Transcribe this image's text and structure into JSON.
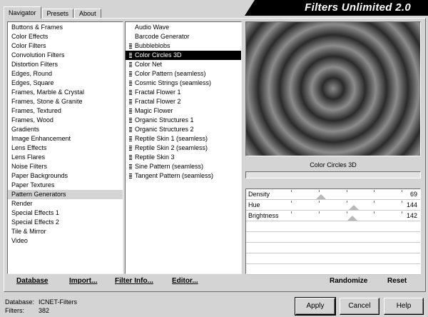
{
  "tabs": [
    "Navigator",
    "Presets",
    "About"
  ],
  "app_title": "Filters Unlimited 2.0",
  "categories": [
    "Buttons & Frames",
    "Color Effects",
    "Color Filters",
    "Convolution Filters",
    "Distortion Filters",
    "Edges, Round",
    "Edges, Square",
    "Frames, Marble & Crystal",
    "Frames, Stone & Granite",
    "Frames, Textured",
    "Frames, Wood",
    "Gradients",
    "Image Enhancement",
    "Lens Effects",
    "Lens Flares",
    "Noise Filters",
    "Paper Backgrounds",
    "Paper Textures",
    "Pattern Generators",
    "Render",
    "Special Effects 1",
    "Special Effects 2",
    "Tile & Mirror",
    "Video"
  ],
  "selected_category": 18,
  "filters": [
    {
      "label": "Audio Wave",
      "marked": false
    },
    {
      "label": "Barcode Generator",
      "marked": false
    },
    {
      "label": "Bubbleblobs",
      "marked": true
    },
    {
      "label": "Color Circles 3D",
      "marked": true
    },
    {
      "label": "Color Net",
      "marked": true
    },
    {
      "label": "Color Pattern (seamless)",
      "marked": true
    },
    {
      "label": "Cosmic Strings (seamless)",
      "marked": true
    },
    {
      "label": "Fractal Flower 1",
      "marked": true
    },
    {
      "label": "Fractal Flower 2",
      "marked": true
    },
    {
      "label": "Magic Flower",
      "marked": true
    },
    {
      "label": "Organic Structures 1",
      "marked": true
    },
    {
      "label": "Organic Structures 2",
      "marked": true
    },
    {
      "label": "Reptile Skin 1 (seamless)",
      "marked": true
    },
    {
      "label": "Reptile Skin 2 (seamless)",
      "marked": true
    },
    {
      "label": "Reptile Skin 3",
      "marked": true
    },
    {
      "label": "Sine Pattern (seamless)",
      "marked": true
    },
    {
      "label": "Tangent Pattern (seamless)",
      "marked": true
    }
  ],
  "selected_filter": 3,
  "preview_name": "Color Circles 3D",
  "sliders": [
    {
      "label": "Density",
      "value": "69",
      "fraction": 0.27
    },
    {
      "label": "Hue",
      "value": "144",
      "fraction": 0.565
    },
    {
      "label": "Brightness",
      "value": "142",
      "fraction": 0.557
    }
  ],
  "empty_slider_rows": 5,
  "actions": {
    "database": "Database",
    "import": "Import...",
    "filter_info": "Filter Info...",
    "editor": "Editor...",
    "randomize": "Randomize",
    "reset": "Reset"
  },
  "status": {
    "database_label": "Database:",
    "database_value": "ICNET-Filters",
    "filters_label": "Filters:",
    "filters_value": "382"
  },
  "buttons": {
    "apply": "Apply",
    "cancel": "Cancel",
    "help": "Help"
  },
  "colors": {
    "ring_dark": "#2a2a2a",
    "ring_light": "#8c8c8c"
  }
}
